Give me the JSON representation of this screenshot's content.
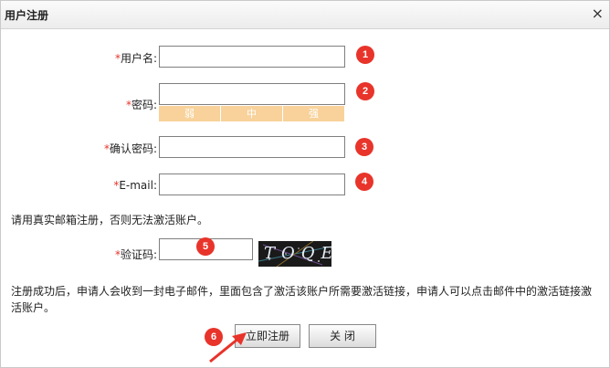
{
  "dialog": {
    "title": "用户注册",
    "close_glyph": "×"
  },
  "form": {
    "required_mark": "*",
    "username": {
      "label": "用户名:",
      "value": ""
    },
    "password": {
      "label": "密码:",
      "value": ""
    },
    "strength": [
      "弱",
      "中",
      "强"
    ],
    "confirm": {
      "label": "确认密码:",
      "value": ""
    },
    "email": {
      "label": "E-mail:",
      "value": ""
    },
    "email_note": "请用真实邮箱注册，否则无法激活账户。",
    "captcha": {
      "label": "验证码:",
      "value": "",
      "image_text": "TOQE"
    },
    "activation_note": "注册成功后，申请人会收到一封电子邮件，里面包含了激活该账户所需要激活链接，申请人可以点击邮件中的激活链接激活账户。"
  },
  "buttons": {
    "register": "立即注册",
    "close": "关 闭"
  },
  "badges": [
    "1",
    "2",
    "3",
    "4",
    "5",
    "6"
  ],
  "colors": {
    "badge": "#e8342a",
    "required": "#e8342a",
    "strength_bar": "#f8d29a"
  }
}
